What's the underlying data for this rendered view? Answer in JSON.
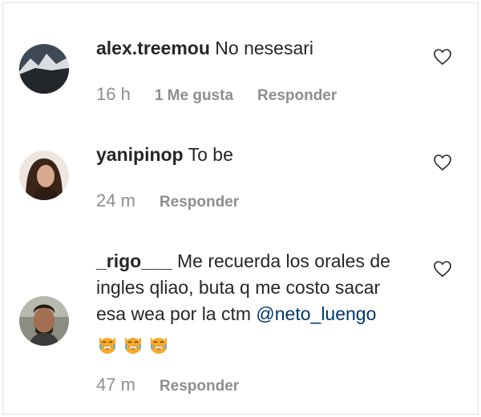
{
  "comments": [
    {
      "username": "alex.treemou",
      "text": "No nesesari",
      "time": "16 h",
      "likes": "1 Me gusta",
      "reply": "Responder"
    },
    {
      "username": "yanipinop",
      "text": "To be",
      "time": "24 m",
      "reply": "Responder"
    },
    {
      "username": "_rigo___",
      "text": "Me recuerda los orales de ingles qliao, buta q me costo sacar esa wea por la ctm",
      "mention": "@neto_luengo",
      "emoji_name": "crying-laughing-cat-face",
      "emoji_count": 3,
      "time": "47 m",
      "reply": "Responder"
    }
  ],
  "colors": {
    "text": "#262626",
    "muted": "#8e8e8e",
    "mention": "#00376b"
  },
  "icons": {
    "like": "heart-outline-icon"
  }
}
